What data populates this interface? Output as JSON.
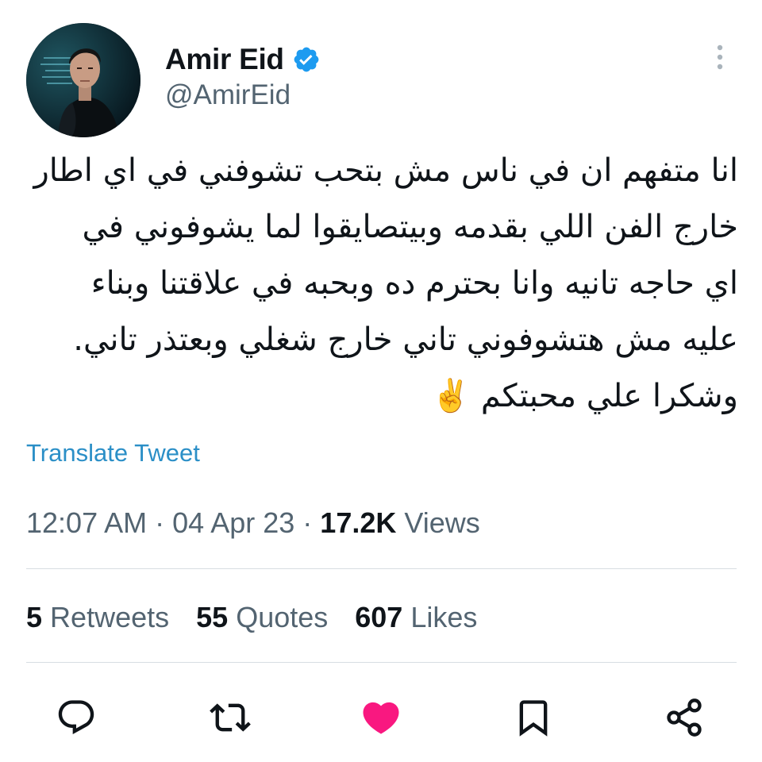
{
  "author": {
    "display_name": "Amir Eid",
    "handle": "@AmirEid",
    "verified": true
  },
  "tweet": {
    "lines": [
      "انا متفهم ان في ناس مش بتحب تشوفني في اي اطار",
      "خارج الفن اللي بقدمه وبيتصايقوا لما يشوفوني في",
      "اي حاجه تانيه  وانا بحترم ده وبحبه في علاقتنا وبناء",
      "عليه مش هتشوفوني تاني خارج شغلي وبعتذر تاني.",
      "وشكرا علي محبتكم ✌️"
    ],
    "translate_label": "Translate Tweet"
  },
  "meta": {
    "time": "12:07 AM",
    "date": "04 Apr 23",
    "views_count": "17.2K",
    "views_label": "Views",
    "separator": "·"
  },
  "stats": {
    "retweets_count": "5",
    "retweets_label": "Retweets",
    "quotes_count": "55",
    "quotes_label": "Quotes",
    "likes_count": "607",
    "likes_label": "Likes"
  },
  "icons": {
    "verified": "verified-badge-icon",
    "more": "more-vertical-icon",
    "reply": "reply-icon",
    "retweet": "retweet-icon",
    "like": "heart-icon",
    "bookmark": "bookmark-icon",
    "share": "share-icon"
  },
  "colors": {
    "verified_blue": "#1d9bf0",
    "like_pink": "#f91880",
    "link_blue": "#2b8fc7",
    "secondary_text": "#536471"
  }
}
